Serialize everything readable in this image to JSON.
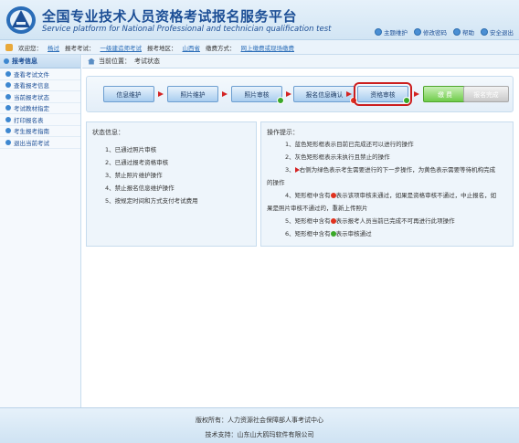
{
  "header": {
    "title_zh": "全国专业技术人员资格考试报名服务平台",
    "title_en": "Service platform for National Professional and technician qualification test",
    "links": [
      "主题维护",
      "修改密码",
      "帮助",
      "安全退出"
    ]
  },
  "infobar": {
    "welcome_label": "欢迎您：",
    "user": "杨过",
    "exam_label": "报考考试：",
    "exam": "一级建造师考试",
    "region_label": "报考地区：",
    "region": "山西省",
    "pay_label": "缴费方式：",
    "pay": "网上缴费或现场缴费"
  },
  "sidebar": {
    "header": "报考信息",
    "items": [
      "查看考试文件",
      "查看报考信息",
      "当前报考状态",
      "考试教材指定",
      "打印报名表",
      "考生报考指南",
      "退出当前考试"
    ]
  },
  "breadcrumb": {
    "label": "当前位置：",
    "value": "考试状态"
  },
  "steps": [
    "信息维护",
    "照片维护",
    "照片审核",
    "报名信息确认",
    "资格审核",
    "缴 费",
    "报名完成"
  ],
  "status": {
    "title": "状态信息：",
    "items": [
      "1、已通过照片审核",
      "2、已通过报考资格审核",
      "3、禁止照片维护操作",
      "4、禁止报名信息维护操作",
      "5、按规定时间和方式支付考试费用"
    ]
  },
  "ops": {
    "title": "操作提示：",
    "items": [
      "1、蓝色矩形框表示目前已完成还可以进行的操作",
      "2、灰色矩形框表示未执行且禁止的操作",
      "3、",
      "右侧为绿色表示考生需要进行的下一步操作，为黄色表示需要等待机构完成",
      "的操作",
      "4、矩形框中含有",
      "表示该项审核未通过，如果是资格审核不通过，中止报名，如",
      "果是照片审核不通过的，重新上传照片",
      "5、矩形框中含有",
      "表示报考人员当前已完成不可再进行此项操作",
      "6、矩形框中含有",
      "表示审核通过"
    ]
  },
  "footer": {
    "copyright": "版权所有：人力资源社会保障部人事考试中心",
    "support": "技术支持：山东山大鸥玛软件有限公司"
  }
}
